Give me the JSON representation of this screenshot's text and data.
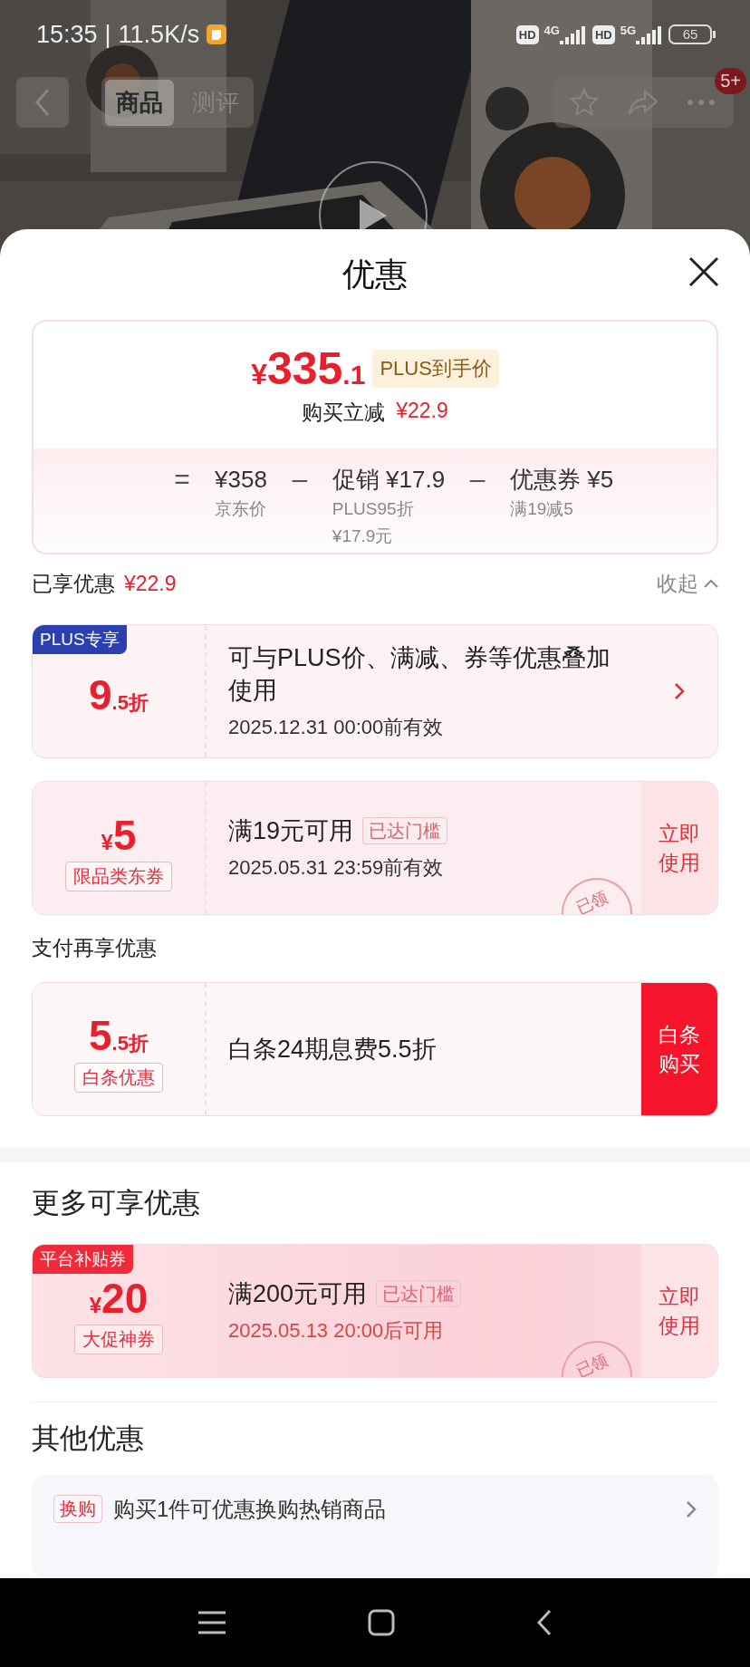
{
  "status_bar": {
    "time": "15:35",
    "separator": "|",
    "speed": "11.5K/s",
    "hd_1": "HD",
    "network_1": "4G",
    "hd_2": "HD",
    "network_2": "5G",
    "battery": "65"
  },
  "header": {
    "tabs": [
      {
        "label": "商品",
        "selected": true
      },
      {
        "label": "测评",
        "selected": false
      }
    ],
    "badge": "5+"
  },
  "sheet": {
    "title": "优惠"
  },
  "price_card": {
    "currency": "¥",
    "price_main": "335",
    "price_decimal": ".1",
    "tag": "PLUS到手价",
    "saving_label": "购买立减",
    "saving": "¥22.9",
    "breakdown": [
      {
        "op": "=",
        "value": "¥358",
        "label": "京东价"
      },
      {
        "op": "–",
        "prefix": "促销",
        "value": "¥17.9",
        "label": "PLUS95折",
        "note": "¥17.9元"
      },
      {
        "op": "–",
        "prefix": "优惠券",
        "value": "¥5",
        "label": "满19减5"
      }
    ]
  },
  "enjoyed": {
    "label": "已享优惠",
    "amount": "¥22.9",
    "toggle": "收起",
    "coupons": [
      {
        "kind": "plus",
        "corner_tag": {
          "text": "PLUS专享",
          "color": "#2b3fae"
        },
        "amount_main": "9",
        "amount_suffix": ".5折",
        "title": "可与PLUS价、满减、券等优惠叠加使用",
        "line2": "2025.12.31 00:00前有效",
        "action": {
          "kind": "chevron"
        }
      },
      {
        "kind": "jd",
        "amount_prefix": "¥",
        "amount_main": "5",
        "sub_tag": "限品类东券",
        "title": "满19元可用",
        "badge": "已达门槛",
        "line2": "2025.05.31 23:59前有效",
        "stamp": "已领",
        "action": {
          "kind": "use",
          "label": "立即使用"
        }
      }
    ]
  },
  "payment": {
    "title": "支付再享优惠",
    "coupons": [
      {
        "kind": "pay",
        "amount_main": "5",
        "amount_suffix": ".5折",
        "sub_tag": "白条优惠",
        "title": "白条24期息费5.5折",
        "action": {
          "kind": "buy",
          "label": "白条购买"
        }
      }
    ]
  },
  "more": {
    "title": "更多可享优惠",
    "coupons": [
      {
        "kind": "promo",
        "corner_tag": {
          "text": "平台补贴券",
          "color": "#ef2b3a"
        },
        "amount_prefix": "¥",
        "amount_main": "20",
        "sub_tag": "大促神券",
        "title": "满200元可用",
        "badge": "已达门槛",
        "line2": "2025.05.13 20:00后可用",
        "stamp": "已领",
        "action": {
          "kind": "use",
          "label": "立即使用"
        }
      }
    ]
  },
  "other": {
    "title": "其他优惠",
    "items": [
      {
        "tag": "换购",
        "text": "购买1件可优惠换购热销商品"
      }
    ]
  }
}
